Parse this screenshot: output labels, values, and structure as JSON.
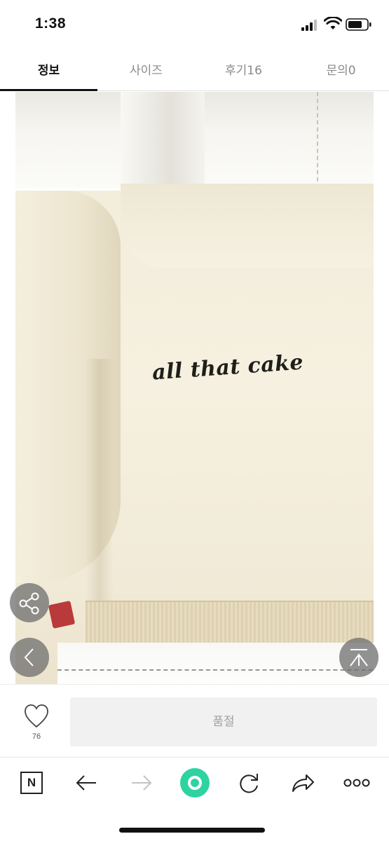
{
  "status_bar": {
    "time": "1:38"
  },
  "tabs": [
    {
      "label": "정보",
      "active": true
    },
    {
      "label": "사이즈",
      "active": false
    },
    {
      "label": "후기16",
      "active": false
    },
    {
      "label": "문의0",
      "active": false
    }
  ],
  "product_image": {
    "print_text": "all that cake"
  },
  "floating_buttons": {
    "share": {
      "icon": "share-icon"
    },
    "prev": {
      "icon": "chevron-left-icon"
    },
    "top": {
      "icon": "scroll-top-icon"
    }
  },
  "purchase_bar": {
    "like_icon": "heart-icon",
    "like_count": "76",
    "soldout_label": "품절"
  },
  "browser_toolbar": {
    "icons": [
      "naver-home-icon",
      "back-arrow-icon",
      "forward-arrow-icon",
      "green-dot-icon",
      "reload-icon",
      "share-arrow-icon",
      "more-icon"
    ],
    "home_label": "N"
  },
  "colors": {
    "accent_green": "#2fd3a0",
    "tab_active": "#111111",
    "tab_inactive": "#8a8a8a",
    "soldout_bg": "#f1f1f1"
  }
}
